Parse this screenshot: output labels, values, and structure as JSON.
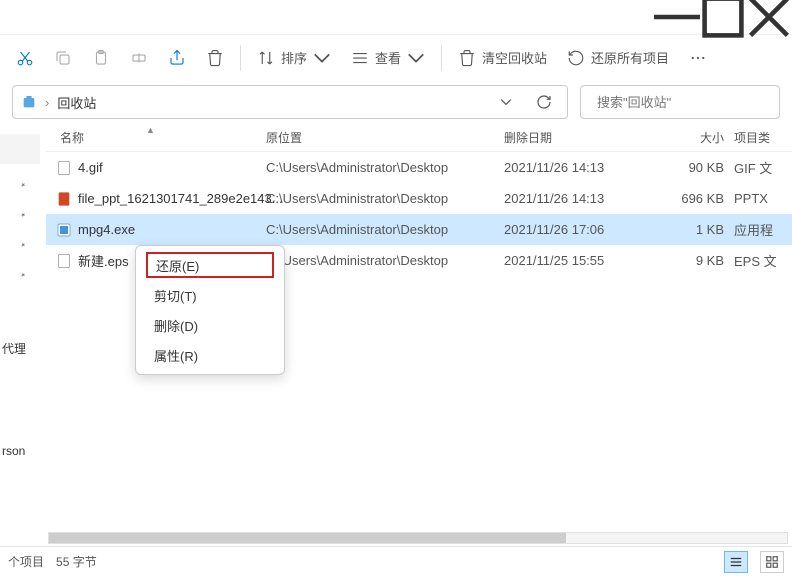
{
  "window": {
    "title": "回收站"
  },
  "toolbar": {
    "sort": "排序",
    "view": "查看",
    "empty": "清空回收站",
    "restore_all": "还原所有项目"
  },
  "breadcrumb": {
    "location": "回收站"
  },
  "search": {
    "placeholder": "搜索\"回收站\""
  },
  "columns": {
    "name": "名称",
    "location": "原位置",
    "date": "删除日期",
    "size": "大小",
    "type": "项目类"
  },
  "rows": [
    {
      "name": "4.gif",
      "location": "C:\\Users\\Administrator\\Desktop",
      "date": "2021/11/26 14:13",
      "size": "90 KB",
      "type": "GIF 文"
    },
    {
      "name": "file_ppt_1621301741_289e2e143...",
      "location": "C:\\Users\\Administrator\\Desktop",
      "date": "2021/11/26 14:13",
      "size": "696 KB",
      "type": "PPTX"
    },
    {
      "name": "mpg4.exe",
      "location": "C:\\Users\\Administrator\\Desktop",
      "date": "2021/11/26 17:06",
      "size": "1 KB",
      "type": "应用程"
    },
    {
      "name": "新建.eps",
      "location": "C:\\Users\\Administrator\\Desktop",
      "date": "2021/11/25 15:55",
      "size": "9 KB",
      "type": "EPS 文"
    }
  ],
  "sidebar": {
    "item1": "代理",
    "item2": "rson"
  },
  "context_menu": {
    "restore": "还原(E)",
    "cut": "剪切(T)",
    "delete": "删除(D)",
    "properties": "属性(R)"
  },
  "status": {
    "items": "个项目",
    "bytes": "55 字节"
  }
}
